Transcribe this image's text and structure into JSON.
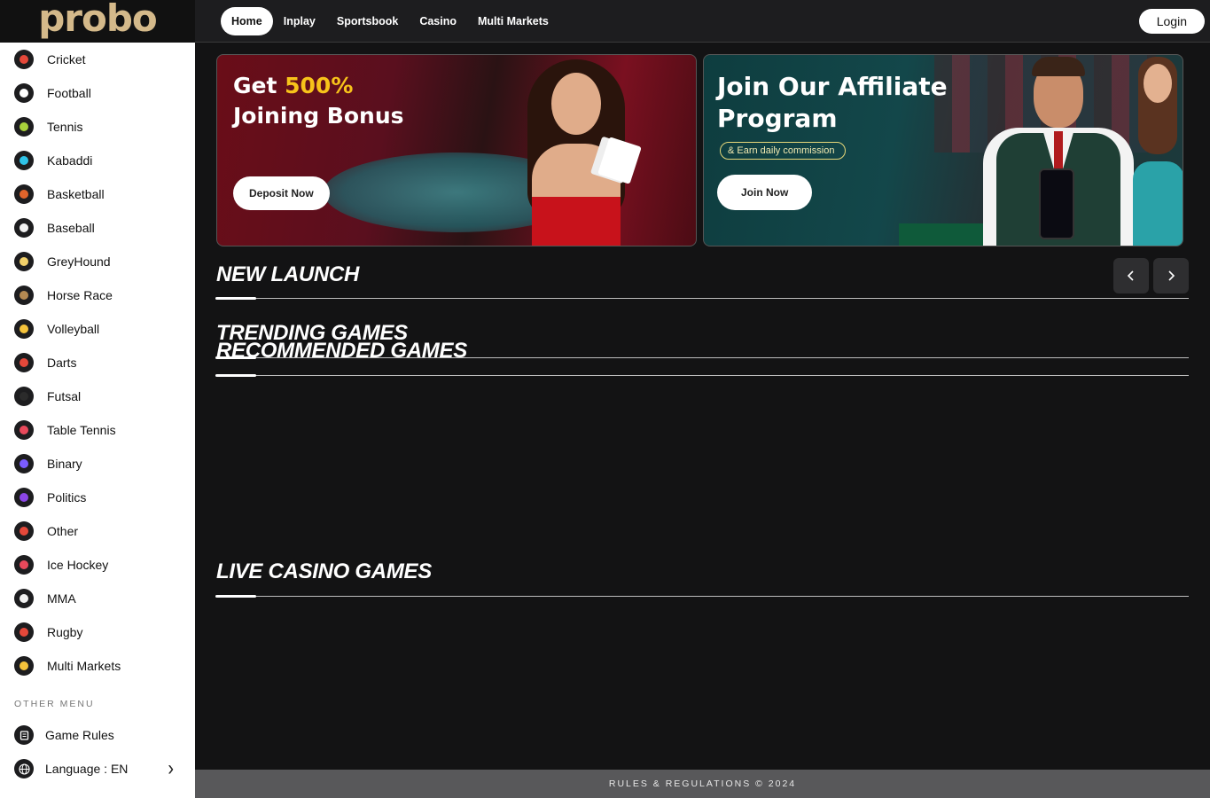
{
  "brand": {
    "logo_text": "probo"
  },
  "sidebar": {
    "items": [
      {
        "label": "Cricket",
        "icon": "cricket-ball-icon",
        "color": "#e5483a"
      },
      {
        "label": "Football",
        "icon": "football-icon",
        "color": "#ffffff"
      },
      {
        "label": "Tennis",
        "icon": "tennis-ball-icon",
        "color": "#a8d13b"
      },
      {
        "label": "Kabaddi",
        "icon": "kabaddi-icon",
        "color": "#2ec3e8"
      },
      {
        "label": "Basketball",
        "icon": "basketball-icon",
        "color": "#e0642b"
      },
      {
        "label": "Baseball",
        "icon": "baseball-icon",
        "color": "#f2f2f2"
      },
      {
        "label": "GreyHound",
        "icon": "greyhound-icon",
        "color": "#f2d16a"
      },
      {
        "label": "Horse Race",
        "icon": "horse-race-icon",
        "color": "#b58a52"
      },
      {
        "label": "Volleyball",
        "icon": "volleyball-icon",
        "color": "#f5c33b"
      },
      {
        "label": "Darts",
        "icon": "darts-icon",
        "color": "#e5483a"
      },
      {
        "label": "Futsal",
        "icon": "futsal-icon",
        "color": "#2b2b2b"
      },
      {
        "label": "Table Tennis",
        "icon": "table-tennis-icon",
        "color": "#e8495b"
      },
      {
        "label": "Binary",
        "icon": "binary-icon",
        "color": "#7b5cff"
      },
      {
        "label": "Politics",
        "icon": "politics-icon",
        "color": "#8b46e6"
      },
      {
        "label": "Other",
        "icon": "other-sport-icon",
        "color": "#e5483a"
      },
      {
        "label": "Ice Hockey",
        "icon": "ice-hockey-icon",
        "color": "#e8495b"
      },
      {
        "label": "MMA",
        "icon": "mma-icon",
        "color": "#f1f1f1"
      },
      {
        "label": "Rugby",
        "icon": "rugby-ball-icon",
        "color": "#e5483a"
      },
      {
        "label": "Multi Markets",
        "icon": "multi-markets-icon",
        "color": "#f5c33b"
      }
    ],
    "other_menu_heading": "OTHER MENU",
    "other_items": [
      {
        "label": "Game Rules",
        "icon": "game-rules-icon"
      },
      {
        "label": "Language : EN",
        "icon": "globe-icon"
      }
    ]
  },
  "nav": {
    "tabs": [
      "Home",
      "Inplay",
      "Sportsbook",
      "Casino",
      "Multi Markets"
    ],
    "active": "Home",
    "login_label": "Login"
  },
  "banners": {
    "bonus": {
      "title_prefix": "Get ",
      "highlight": "500%",
      "title_line2": "Joining Bonus",
      "button": "Deposit Now"
    },
    "affiliate": {
      "title_line1": "Join Our Affiliate",
      "title_line2": "Program",
      "tag": "& Earn daily commission",
      "button": "Join Now"
    }
  },
  "sections": {
    "new_launch": "NEW LAUNCH",
    "trending": "TRENDING GAMES",
    "recommended": "RECOMMENDED GAMES",
    "live_casino": "LIVE CASINO GAMES"
  },
  "footer": {
    "text": "RULES & REGULATIONS © 2024"
  },
  "colors": {
    "accent_yellow": "#f7c31a",
    "page_bg": "#131314",
    "topbar_bg": "#1d1d1f",
    "footer_bg": "#58585a"
  }
}
